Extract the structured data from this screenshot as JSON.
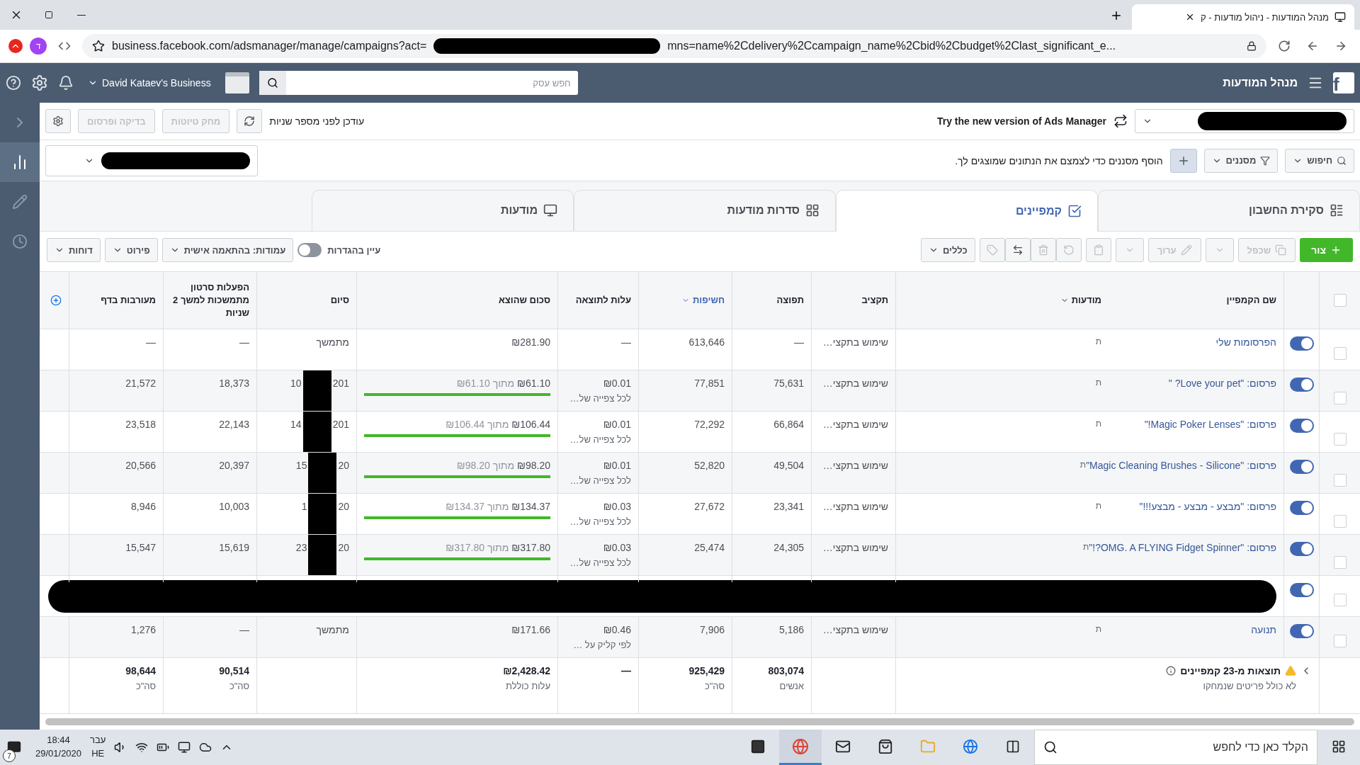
{
  "browser": {
    "tab_title": "מנהל המודעות - ניהול מודעות - ק",
    "url_start": "business.facebook.com/adsmanager/manage/campaigns?act=",
    "url_end": "mns=name%2Cdelivery%2Ccampaign_name%2Cbid%2Cbudget%2Clast_significant_e...",
    "profile_initial": "ד"
  },
  "topbar": {
    "logo": "f",
    "title": "מנהל המודעות",
    "search_placeholder": "חפש עסק",
    "business": "David Kataev's Business"
  },
  "toolbar": {
    "try_new": "Try the new version of Ads Manager",
    "updated": "עודכן לפני מספר שניות",
    "buttons": [
      {
        "label": "מחק טיוטות",
        "disabled": true
      },
      {
        "label": "בדיקה ופרסום",
        "disabled": true
      }
    ]
  },
  "filters": {
    "search_label": "חיפוש",
    "filters_label": "מסננים",
    "hint": "הוסף מסננים כדי לצמצם את הנתונים שמוצגים לך."
  },
  "tabs": [
    {
      "label": "סקירת החשבון",
      "selected": false
    },
    {
      "label": "קמפיינים",
      "selected": true
    },
    {
      "label": "סדרות מודעות",
      "selected": false
    },
    {
      "label": "מודעות",
      "selected": false
    }
  ],
  "actions": {
    "create": "צור",
    "duplicate": {
      "label": "שכפל",
      "disabled": true
    },
    "edit": {
      "label": "ערוך",
      "disabled": true
    },
    "rules": "כללים",
    "settings_toggle": {
      "label": "עיין בהגדרות",
      "on": false
    },
    "columns_label": "עמודות:",
    "columns_value": "בהתאמה אישית",
    "breakdown": "פירוט",
    "reports": "דוחות"
  },
  "table": {
    "select_all_selected": false,
    "columns": {
      "name": "שם הקמפיין",
      "delivery": "מודעות",
      "budget": "תקציב",
      "reach": "תפוצה",
      "impressions": "חשיפות",
      "cost": "עלות לתוצאה",
      "spent": "סכום שהוצא",
      "end": "סיום",
      "thruplay": "הפעלות סרטון מתמשכות למשך 2 שניות",
      "engagement": "מעורבות בדף"
    },
    "rows": [
      {
        "kind": "campaign",
        "selected": false,
        "on": true,
        "name": "הפרסומות שלי",
        "delivery": "ת",
        "budget": "שימוש בתקצי…",
        "reach": "—",
        "impressions": "613,646",
        "cost": "—",
        "spent": "₪281.90",
        "end": "מתמשך",
        "thruplay": "—",
        "engagement": "—"
      },
      {
        "kind": "campaign",
        "selected": false,
        "on": true,
        "name": "פרסום: \"Love your pet? \"",
        "delivery": "ת",
        "budget": "שימוש בתקצי…",
        "reach": "75,631",
        "impressions": "77,851",
        "cost": "₪0.01",
        "cost_note": "לכל צפייה של…",
        "spent": "₪61.10",
        "of": "מתוך",
        "spent_budget": "₪61.10",
        "level": 1,
        "end": "201",
        "end_tail": "10",
        "thruplay": "18,373",
        "engagement": "21,572"
      },
      {
        "kind": "campaign",
        "selected": false,
        "on": true,
        "name": "פרסום: \"Magic Poker Lenses!\"",
        "delivery": "ת",
        "budget": "שימוש בתקצי…",
        "reach": "66,864",
        "impressions": "72,292",
        "cost": "₪0.01",
        "cost_note": "לכל צפייה של…",
        "spent": "₪106.44",
        "of": "מתוך",
        "spent_budget": "₪106.44",
        "level": 1,
        "end": "201",
        "end_tail": "14",
        "thruplay": "22,143",
        "engagement": "23,518"
      },
      {
        "kind": "campaign",
        "selected": false,
        "on": true,
        "name": "פרסום: \"Magic Cleaning Brushes - Silicone\"",
        "delivery": "ת",
        "budget": "שימוש בתקצי…",
        "reach": "49,504",
        "impressions": "52,820",
        "cost": "₪0.01",
        "cost_note": "לכל צפייה של…",
        "spent": "₪98.20",
        "of": "מתוך",
        "spent_budget": "₪98.20",
        "level": 1,
        "end": "20",
        "end_tail": "15",
        "thruplay": "20,397",
        "engagement": "20,566"
      },
      {
        "kind": "campaign",
        "selected": false,
        "on": true,
        "name": "פרסום: \"מבצע - מבצע - מבצע!!!\"",
        "delivery": "ת",
        "budget": "שימוש בתקצי…",
        "reach": "23,341",
        "impressions": "27,672",
        "cost": "₪0.03",
        "cost_note": "לכל צפייה של…",
        "spent": "₪134.37",
        "of": "מתוך",
        "spent_budget": "₪134.37",
        "level": 1,
        "end": "20",
        "end_tail": "1",
        "thruplay": "10,003",
        "engagement": "8,946"
      },
      {
        "kind": "campaign",
        "selected": false,
        "on": true,
        "name": "פרסום: \"OMG. A FLYING Fidget Spinner?!\"",
        "delivery": "ת",
        "budget": "שימוש בתקצי…",
        "reach": "24,305",
        "impressions": "25,474",
        "cost": "₪0.03",
        "cost_note": "לכל צפייה של…",
        "spent": "₪317.80",
        "of": "מתוך",
        "spent_budget": "₪317.80",
        "level": 1,
        "end": "20",
        "end_tail": "23",
        "thruplay": "15,619",
        "engagement": "15,547"
      },
      {
        "kind": "redacted",
        "selected": false,
        "on": true
      },
      {
        "kind": "campaign",
        "selected": false,
        "on": true,
        "name": "תנועה",
        "delivery": "ת",
        "budget": "שימוש בתקצי…",
        "reach": "5,186",
        "impressions": "7,906",
        "cost": "₪0.46",
        "cost_note": "לפי קליק על …",
        "spent": "₪171.66",
        "end": "מתמשך",
        "thruplay": "—",
        "engagement": "1,276"
      }
    ],
    "totals": {
      "title": "תוצאות מ-23 קמפיינים",
      "note": "לא כולל פריטים שנמחקו",
      "reach": "803,074",
      "reach_note": "אנשים",
      "impressions": "925,429",
      "impressions_note": "סה\"כ",
      "cost": "—",
      "spent": "₪2,428.42",
      "spent_note": "עלות כוללת",
      "thruplay": "90,514",
      "thruplay_note": "סה\"כ",
      "engagement": "98,644",
      "engagement_note": "סה\"כ"
    }
  },
  "taskbar": {
    "search_placeholder": "הקלד כאן כדי לחפש",
    "language_top": "עבר",
    "language_bottom": "HE",
    "time": "18:44",
    "date": "29/01/2020",
    "notifications": "7"
  }
}
